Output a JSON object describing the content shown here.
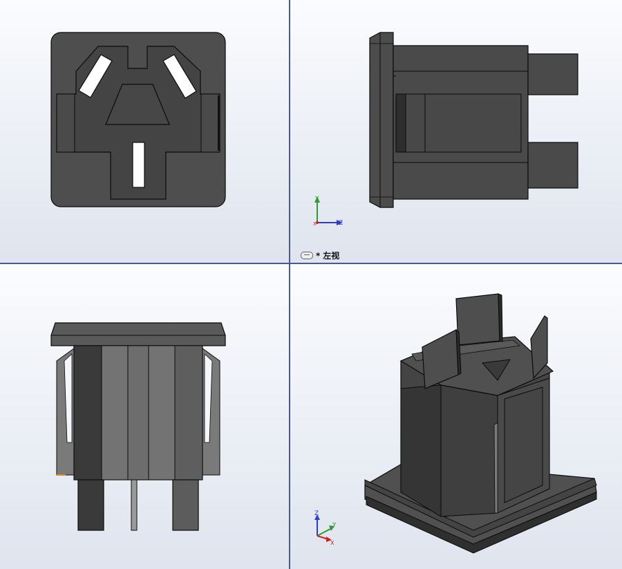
{
  "views": {
    "front": {
      "name": ""
    },
    "left": {
      "label_prefix": "*",
      "label_name": "左视"
    },
    "top": {
      "name": ""
    },
    "iso": {
      "name": ""
    }
  },
  "triad": {
    "left_view": {
      "up": "Y",
      "right": "Z",
      "origin": "X"
    },
    "iso_view": {
      "up": "Z",
      "right": "Y",
      "down": "X"
    }
  },
  "colors": {
    "body_dark": "#3d3d3d",
    "body_mid": "#555555",
    "body_light": "#777777",
    "edge": "#0a0a0a",
    "slot": "#ffffff",
    "background_top": "#fbfcfe",
    "background_bottom": "#dfe4ee",
    "split": "#4a5a86",
    "axis_y": "#2e9b2e",
    "axis_z": "#2d3bd0",
    "axis_x": "#d02020"
  },
  "icons": {
    "view_link": "chain-link-icon"
  }
}
